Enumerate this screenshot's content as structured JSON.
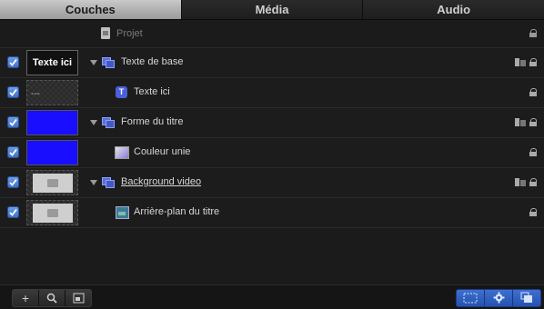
{
  "tabs": [
    {
      "label": "Couches",
      "active": true
    },
    {
      "label": "Média",
      "active": false
    },
    {
      "label": "Audio",
      "active": false
    }
  ],
  "project": {
    "label": "Projet"
  },
  "layers": [
    {
      "name": "Texte de base",
      "thumb": "Texte ici",
      "thumb_type": "text",
      "type": "group",
      "checked": true
    },
    {
      "name": "Texte ici",
      "thumb": "---",
      "thumb_type": "transparent",
      "type": "text",
      "checked": true
    },
    {
      "name": "Forme du titre",
      "thumb_type": "blue",
      "type": "group",
      "checked": true
    },
    {
      "name": "Couleur unie",
      "thumb_type": "blue",
      "type": "generator",
      "checked": true
    },
    {
      "name": "Background video",
      "thumb_type": "gray",
      "type": "group",
      "checked": true
    },
    {
      "name": "Arrière-plan du titre",
      "thumb_type": "gray",
      "type": "image",
      "checked": true
    }
  ],
  "toolbar": {
    "add_label": "+",
    "left_icons": [
      "add-icon",
      "search-icon",
      "thumbnail-icon"
    ],
    "right_icons": [
      "dashed-box-icon",
      "gear-icon",
      "layers-stack-icon"
    ]
  },
  "colors": {
    "accent": "#3d6fc9",
    "shape_fill": "#1a0eff"
  }
}
